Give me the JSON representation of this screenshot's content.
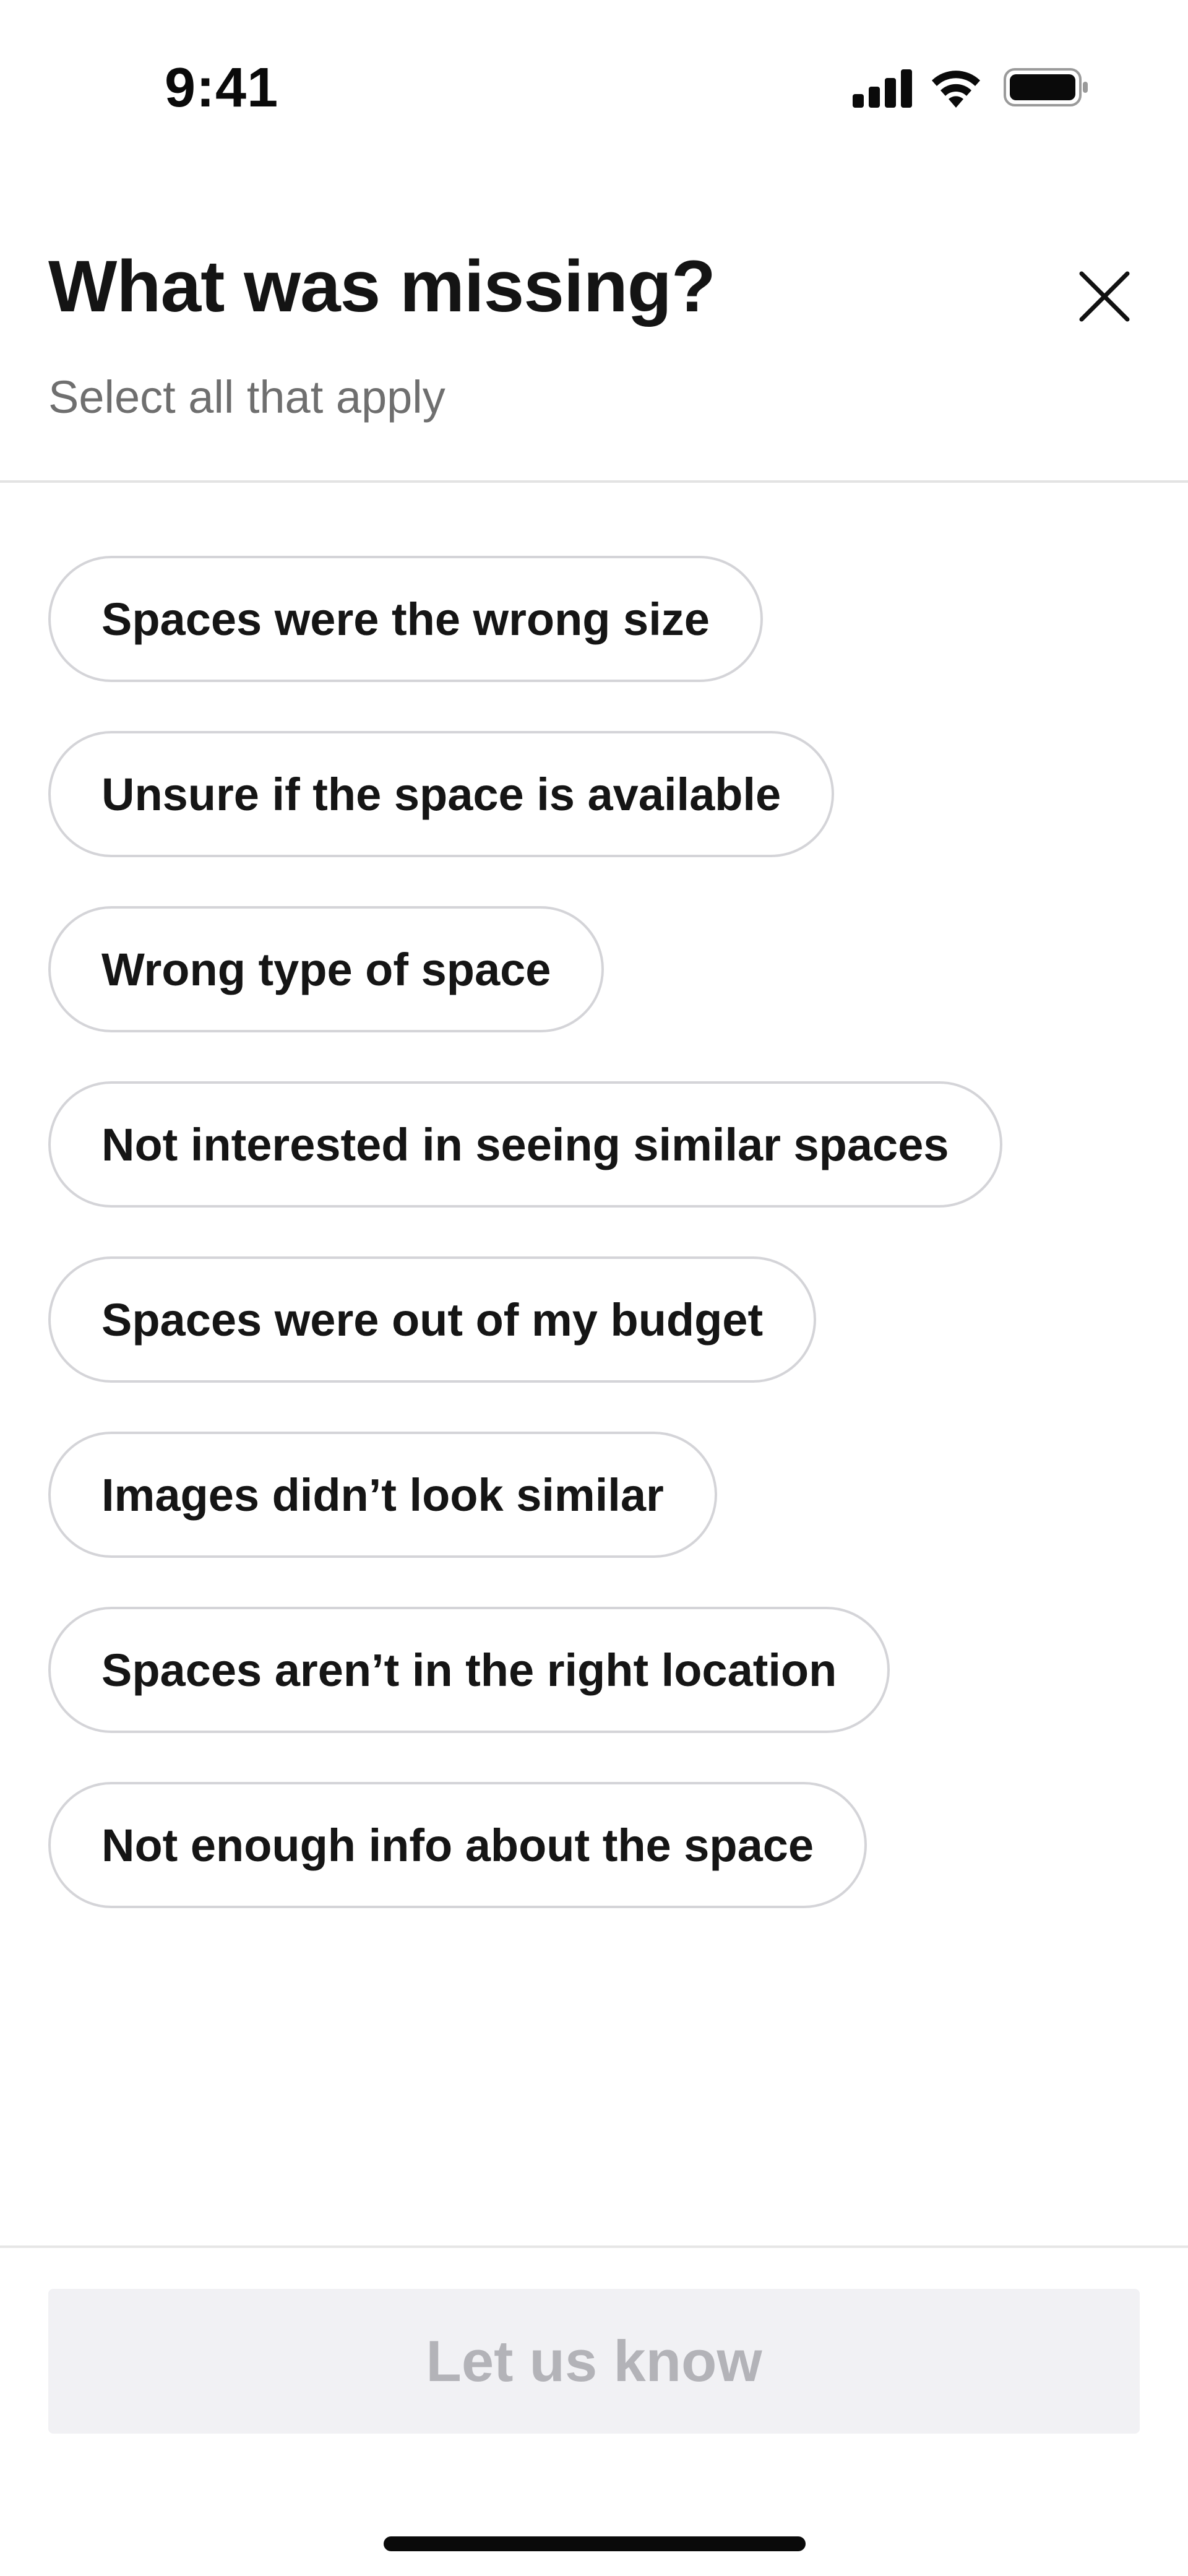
{
  "status_bar": {
    "time": "9:41",
    "icons": [
      "cellular-signal-icon",
      "wifi-icon",
      "battery-icon"
    ]
  },
  "header": {
    "title": "What was missing?",
    "subtitle": "Select all that apply",
    "close_icon": "close-icon"
  },
  "options": [
    {
      "label": "Spaces were the wrong size",
      "selected": false
    },
    {
      "label": "Unsure if the space is available",
      "selected": false
    },
    {
      "label": "Wrong type of space",
      "selected": false
    },
    {
      "label": "Not interested in seeing similar spaces",
      "selected": false
    },
    {
      "label": "Spaces were out of my budget",
      "selected": false
    },
    {
      "label": "Images didn’t look similar",
      "selected": false
    },
    {
      "label": "Spaces aren’t in the right location",
      "selected": false
    },
    {
      "label": "Not enough info about the space",
      "selected": false
    }
  ],
  "footer": {
    "submit_label": "Let us know",
    "submit_enabled": false
  },
  "colors": {
    "chip_border": "#d4d4d8",
    "subtitle_text": "#6f6f6f",
    "disabled_button_bg": "#f1f1f4",
    "disabled_button_text": "#b3b3b8"
  }
}
